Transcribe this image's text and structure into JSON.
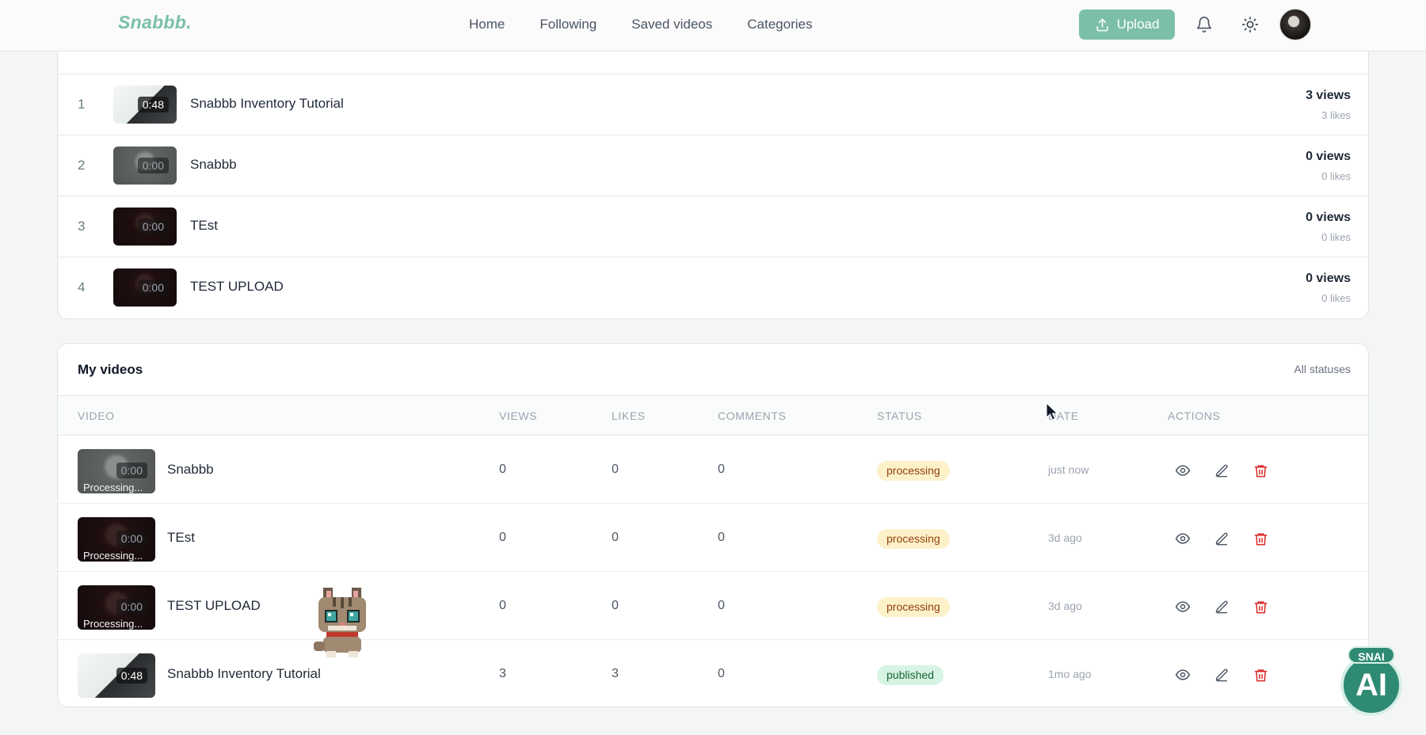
{
  "nav": {
    "logo": "Snabbb.",
    "links": [
      "Home",
      "Following",
      "Saved videos",
      "Categories"
    ],
    "upload_label": "Upload"
  },
  "top_videos": {
    "rows": [
      {
        "rank": "1",
        "title": "Snabbb Inventory Tutorial",
        "duration": "0:48",
        "views": "3 views",
        "likes": "3 likes",
        "thumb": "light"
      },
      {
        "rank": "2",
        "title": "Snabbb",
        "duration": "0:00",
        "views": "0 views",
        "likes": "0 likes",
        "thumb": "grey"
      },
      {
        "rank": "3",
        "title": "TEst",
        "duration": "0:00",
        "views": "0 views",
        "likes": "0 likes",
        "thumb": "dark"
      },
      {
        "rank": "4",
        "title": "TEST UPLOAD",
        "duration": "0:00",
        "views": "0 views",
        "likes": "0 likes",
        "thumb": "dark"
      }
    ]
  },
  "my_videos": {
    "title": "My videos",
    "filter": "All statuses",
    "columns": {
      "video": "VIDEO",
      "views": "VIEWS",
      "likes": "LIKES",
      "comments": "COMMENTS",
      "status": "STATUS",
      "date": "DATE",
      "actions": "ACTIONS"
    },
    "rows": [
      {
        "title": "Snabbb",
        "duration": "0:00",
        "overlay": "Processing...",
        "views": "0",
        "likes": "0",
        "comments": "0",
        "status": "processing",
        "date": "just now",
        "thumb": "grey"
      },
      {
        "title": "TEst",
        "duration": "0:00",
        "overlay": "Processing...",
        "views": "0",
        "likes": "0",
        "comments": "0",
        "status": "processing",
        "date": "3d ago",
        "thumb": "dark"
      },
      {
        "title": "TEST UPLOAD",
        "duration": "0:00",
        "overlay": "Processing...",
        "views": "0",
        "likes": "0",
        "comments": "0",
        "status": "processing",
        "date": "3d ago",
        "thumb": "dark"
      },
      {
        "title": "Snabbb Inventory Tutorial",
        "duration": "0:48",
        "overlay": "",
        "views": "3",
        "likes": "3",
        "comments": "0",
        "status": "published",
        "date": "1mo ago",
        "thumb": "light"
      }
    ]
  },
  "assistant": {
    "tag": "SNAI",
    "label": "AI"
  },
  "colors": {
    "brand": "#7bbfa8",
    "danger": "#dc2626",
    "fab": "#2f8a74"
  },
  "icons": [
    "upload-icon",
    "bell-icon",
    "sun-icon",
    "eye-icon",
    "pencil-icon",
    "trash-icon"
  ]
}
